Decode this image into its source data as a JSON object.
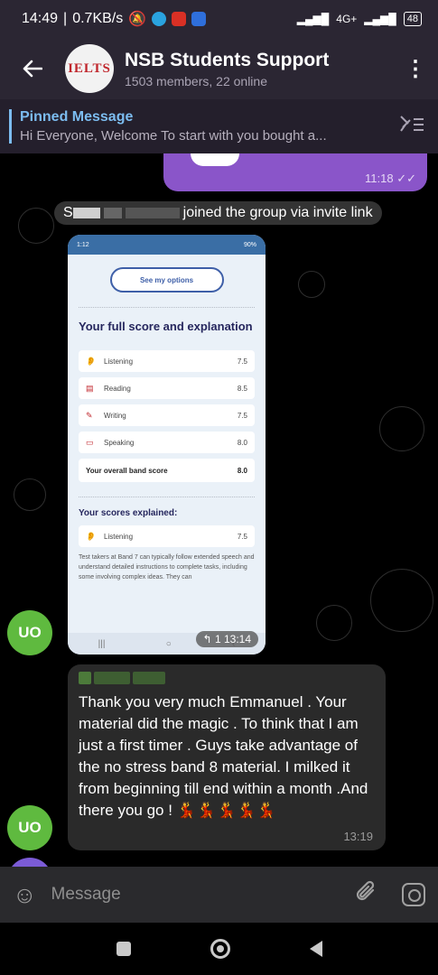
{
  "status_bar": {
    "time": "14:49",
    "speed": "0.7KB/s",
    "network": "4G+",
    "battery": "48"
  },
  "header": {
    "title": "NSB Students Support",
    "subtitle": "1503 members, 22 online",
    "avatar_logo": "IELTS"
  },
  "pinned": {
    "title": "Pinned Message",
    "text": "Hi Everyone,   Welcome   To start with you bought a..."
  },
  "messages": {
    "outgoing_time": "11:18",
    "service_text": "joined the group via invite link",
    "service_prefix": "S",
    "photo_time": "13:14",
    "photo_forward": "1",
    "text_message": "Thank you very much Emmanuel . Your material did the magic . To think that I am just a first timer . Guys take advantage of the no stress band 8 material. I milked it from beginning till end within a month .And there you go !",
    "text_time": "13:19",
    "emoji_tail": "💃💃💃💃💃"
  },
  "avatars": {
    "initials": "UO",
    "color": "#5fba3f"
  },
  "screenshot_content": {
    "status_time": "1:12",
    "battery": "90%",
    "options_button": "See my options",
    "heading": "Your full score and explanation",
    "scores": [
      {
        "skill": "Listening",
        "score": "7.5"
      },
      {
        "skill": "Reading",
        "score": "8.5"
      },
      {
        "skill": "Writing",
        "score": "7.5"
      },
      {
        "skill": "Speaking",
        "score": "8.0"
      }
    ],
    "overall_label": "Your overall band score",
    "overall_score": "8.0",
    "explained_heading": "Your scores explained:",
    "explained_skill": "Listening",
    "explained_score": "7.5",
    "paragraph": "Test takers at Band 7 can typically follow extended speech and understand detailed instructions to complete tasks, including some involving complex ideas. They can"
  },
  "input": {
    "placeholder": "Message"
  },
  "icons": {
    "back": "back-arrow-icon",
    "menu": "more-vertical-icon",
    "unpin": "pin-list-icon",
    "emoji": "emoji-icon",
    "attach": "paperclip-icon",
    "camera": "camera-icon"
  },
  "colors": {
    "accent_blue": "#7cbcf0",
    "outgoing_bubble": "#8a55c9",
    "incoming_bubble": "#2a2a2a",
    "header_bg": "#2b2633"
  }
}
